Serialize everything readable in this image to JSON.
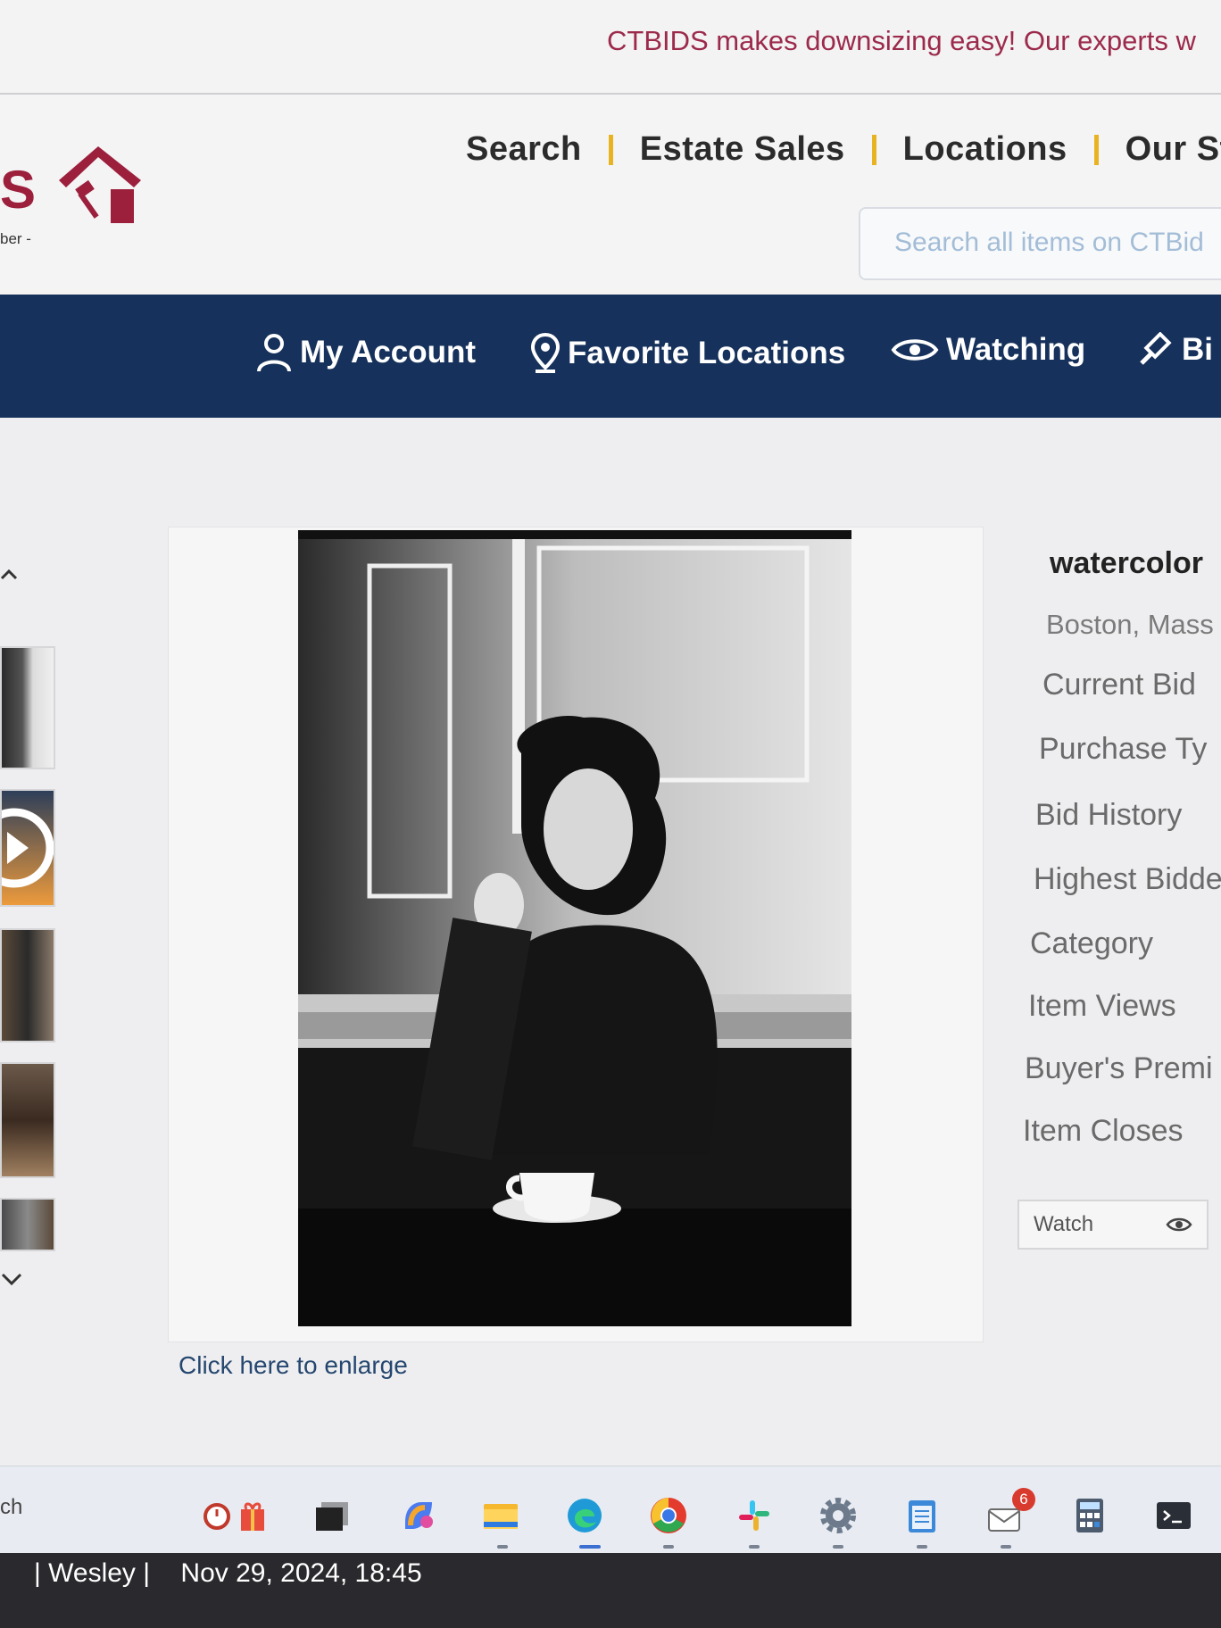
{
  "promo": {
    "text": "CTBIDS makes downsizing easy! Our experts w"
  },
  "logo": {
    "letters": "S",
    "tagline": "ber -"
  },
  "nav": {
    "items": [
      "Search",
      "Estate Sales",
      "Locations",
      "Our Sto"
    ]
  },
  "search": {
    "placeholder": "Search all items on CTBid"
  },
  "account_bar": {
    "my_account": "My Account",
    "favorite_locations": "Favorite Locations",
    "watching": "Watching",
    "bids": "Bi"
  },
  "image": {
    "enlarge_link": "Click here to enlarge"
  },
  "item": {
    "title": "watercolor",
    "location": "Boston, Mass",
    "labels": [
      "Current Bid",
      "Purchase Ty",
      "Bid History",
      "Highest Bidde",
      "Category",
      "Item Views",
      "Buyer's Premi",
      "Item Closes"
    ],
    "watch_label": "Watch"
  },
  "taskbar": {
    "search_fragment": "ch",
    "mail_badge": "6"
  },
  "overlay": {
    "user": "| Wesley |",
    "timestamp": "Nov 29, 2024, 18:45"
  },
  "colors": {
    "brand": "#9c1f3c",
    "nav_bar": "#16315b",
    "separator": "#e8b321",
    "link": "#25476f"
  },
  "icons": [
    "user-icon",
    "location-pin-icon",
    "eye-icon",
    "gavel-icon",
    "chevron-up-icon",
    "chevron-down-icon",
    "play-icon",
    "alarm-clock-icon",
    "gift-icon",
    "task-view-icon",
    "copilot-icon",
    "file-explorer-icon",
    "edge-icon",
    "chrome-icon",
    "slack-icon",
    "settings-icon",
    "notepad-icon",
    "mail-icon",
    "calculator-icon",
    "terminal-icon"
  ]
}
